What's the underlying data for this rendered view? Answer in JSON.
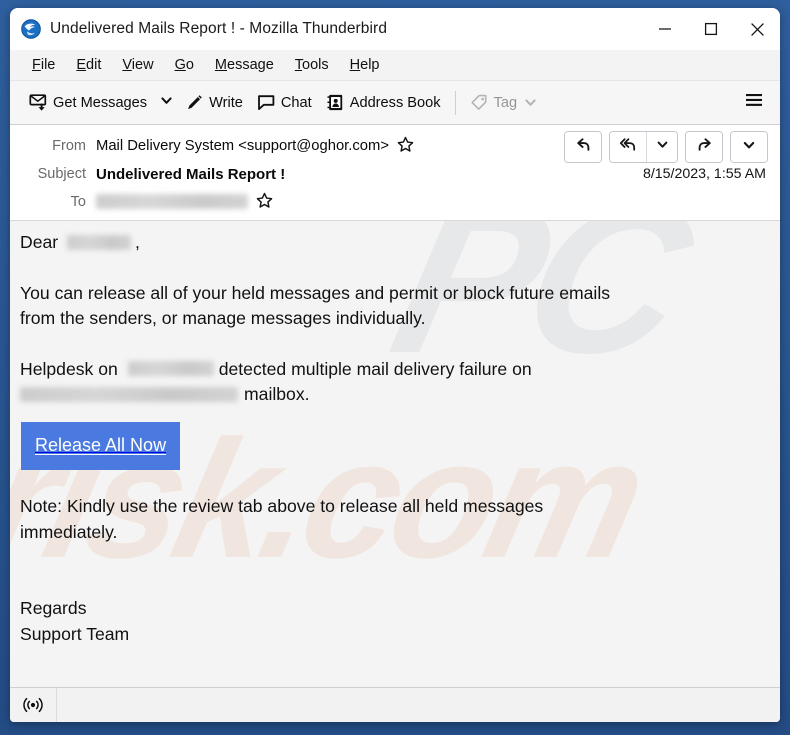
{
  "window": {
    "title": "Undelivered Mails Report ! - Mozilla Thunderbird",
    "app_icon": "thunderbird-logo-icon",
    "controls": {
      "minimize": "minimize-icon",
      "maximize": "maximize-icon",
      "close": "close-icon"
    }
  },
  "menubar": {
    "items": [
      {
        "label": "File",
        "accesskey": "F"
      },
      {
        "label": "Edit",
        "accesskey": "E"
      },
      {
        "label": "View",
        "accesskey": "V"
      },
      {
        "label": "Go",
        "accesskey": "G"
      },
      {
        "label": "Message",
        "accesskey": "M"
      },
      {
        "label": "Tools",
        "accesskey": "T"
      },
      {
        "label": "Help",
        "accesskey": "H"
      }
    ]
  },
  "toolbar": {
    "get_messages_label": "Get Messages",
    "get_messages_icon": "get-messages-icon",
    "get_messages_caret": "chevron-down-icon",
    "write_label": "Write",
    "write_icon": "pencil-icon",
    "chat_label": "Chat",
    "chat_icon": "chat-bubble-icon",
    "address_book_label": "Address Book",
    "address_book_icon": "address-book-icon",
    "tag_label": "Tag",
    "tag_icon": "tag-icon",
    "tag_caret": "chevron-down-icon",
    "tag_disabled": true,
    "app_menu_icon": "hamburger-menu-icon"
  },
  "message_header": {
    "from_label": "From",
    "from_value": "Mail Delivery System <support@oghor.com>",
    "from_star_icon": "star-outline-icon",
    "subject_label": "Subject",
    "subject_value": "Undelivered Mails Report !",
    "date": "8/15/2023, 1:55 AM",
    "to_label": "To",
    "to_value_redacted": true,
    "to_star_icon": "star-outline-icon",
    "actions": {
      "reply_icon": "reply-icon",
      "reply_all_icon": "reply-all-icon",
      "reply_all_caret": "chevron-down-icon",
      "forward_icon": "forward-icon",
      "more_caret": "chevron-down-icon"
    }
  },
  "body": {
    "greeting_prefix": "Dear",
    "greeting_suffix": ",",
    "paragraph_1_line_1": "You can release all of your held messages and permit or block future emails",
    "paragraph_1_line_2": "from the senders, or manage messages individually.",
    "paragraph_2_prefix": "Helpdesk on",
    "paragraph_2_middle": "detected multiple mail delivery failure on",
    "paragraph_2_suffix": "mailbox.",
    "release_button_label": "Release All Now",
    "release_button_color": "#4a7ae0",
    "note_line_1": "Note:  Kindly use the review tab above to release all held messages",
    "note_line_2": "immediately.",
    "signoff_line_1": "Regards",
    "signoff_line_2": "Support Team",
    "watermark_1": "PC",
    "watermark_2": "risk.com"
  },
  "statusbar": {
    "icon": "broadcast-icon",
    "text": ""
  }
}
